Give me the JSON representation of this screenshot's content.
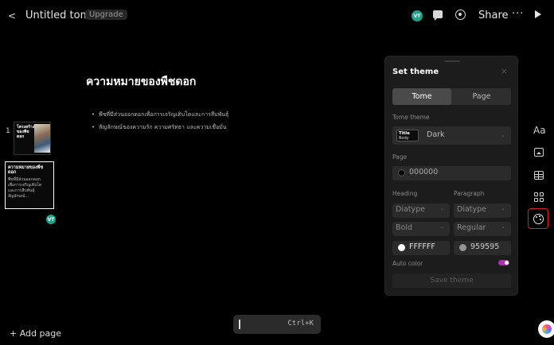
{
  "header": {
    "back_glyph": "<",
    "doc_title": "Untitled tome",
    "upgrade_label": "Upgrade",
    "avatar_initials": "VT",
    "share_label": "Share",
    "more_glyph": "···"
  },
  "sidebar": {
    "thumbnails": [
      {
        "number": "1",
        "title": "โครงสร้างของพืชดอก"
      },
      {
        "number": "2",
        "title": "ความหมายของพืชดอก",
        "body": "พืชที่มีส่วนออกดอกเพื่อการเจริญเติบโตและการสืบพันธุ์ สัญลักษณ์..."
      }
    ],
    "thumb_avatar": "VT",
    "add_page_label": "+ Add page"
  },
  "slide": {
    "title": "ความหมายของพืชดอก",
    "bullets": [
      "พืชที่มีส่วนออกดอกเพื่อการเจริญเติบโตและการสืบพันธุ์",
      "สัญลักษณ์ของความรัก ความศรัทธา และความเชื่อมั่น"
    ]
  },
  "command_bar": {
    "shortcut": "Ctrl+K"
  },
  "theme_panel": {
    "title": "Set theme",
    "close_glyph": "×",
    "tabs": {
      "tome": "Tome",
      "page": "Page"
    },
    "tome_theme_label": "Tome theme",
    "theme_swatch_title": "Title",
    "theme_swatch_body": "Body",
    "theme_name": "Dark",
    "page_label": "Page",
    "page_color": "000000",
    "heading_label": "Heading",
    "paragraph_label": "Paragraph",
    "heading_font": "Diatype",
    "paragraph_font": "Diatype",
    "heading_weight": "Bold",
    "paragraph_weight": "Regular",
    "heading_color": "FFFFFF",
    "paragraph_color": "959595",
    "auto_color_label": "Auto color",
    "auto_color_on": true,
    "save_label": "Save theme"
  },
  "right_rail": {
    "text_label": "Aa",
    "icons": [
      "text-icon",
      "image-icon",
      "table-icon",
      "grid-icon",
      "palette-icon"
    ]
  },
  "colors": {
    "background": "#000000",
    "panel": "#1c1c1c",
    "accent_toggle": "#b62bb3",
    "highlight_border": "#e02020",
    "avatar": "#1fa38a"
  }
}
